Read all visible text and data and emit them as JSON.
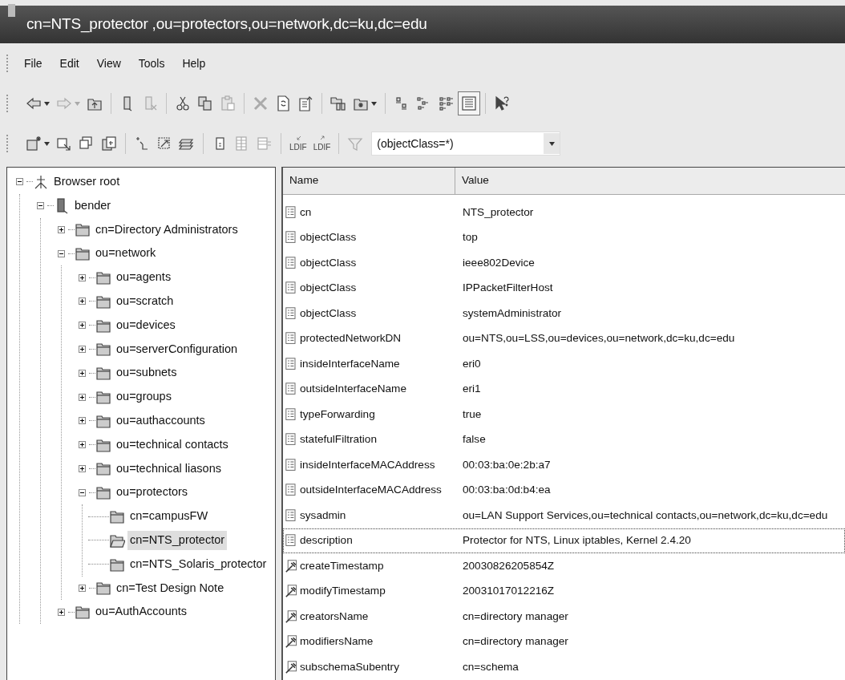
{
  "window": {
    "title": "cn=NTS_protector ,ou=protectors,ou=network,dc=ku,dc=edu"
  },
  "menu": [
    "File",
    "Edit",
    "View",
    "Tools",
    "Help"
  ],
  "toolbars": [
    [
      {
        "kind": "button",
        "dropdown": true,
        "disabled": false
      },
      {
        "kind": "button",
        "dropdown": true,
        "disabled": true
      },
      {
        "kind": "button",
        "dropdown": false,
        "disabled": false
      },
      {
        "kind": "separator"
      },
      {
        "kind": "button",
        "dropdown": false,
        "disabled": false
      },
      {
        "kind": "button",
        "dropdown": false,
        "disabled": true
      },
      {
        "kind": "separator"
      },
      {
        "kind": "button",
        "dropdown": false,
        "disabled": false
      },
      {
        "kind": "button",
        "dropdown": false,
        "disabled": false
      },
      {
        "kind": "button",
        "dropdown": false,
        "disabled": true
      },
      {
        "kind": "separator"
      },
      {
        "kind": "button",
        "dropdown": false,
        "disabled": true
      },
      {
        "kind": "button",
        "dropdown": false,
        "disabled": false
      },
      {
        "kind": "button",
        "dropdown": false,
        "disabled": false
      },
      {
        "kind": "separator"
      },
      {
        "kind": "button",
        "dropdown": false,
        "disabled": false
      },
      {
        "kind": "button",
        "dropdown": true,
        "disabled": false
      },
      {
        "kind": "separator"
      },
      {
        "kind": "button",
        "dropdown": false,
        "disabled": false,
        "selected": false
      },
      {
        "kind": "button",
        "dropdown": false,
        "disabled": false,
        "selected": false
      },
      {
        "kind": "button",
        "dropdown": false,
        "disabled": false,
        "selected": false
      },
      {
        "kind": "button",
        "dropdown": false,
        "disabled": false,
        "selected": true
      },
      {
        "kind": "separator"
      },
      {
        "kind": "button",
        "dropdown": false,
        "disabled": false
      }
    ],
    [
      {
        "kind": "button",
        "dropdown": true,
        "disabled": false
      },
      {
        "kind": "button",
        "dropdown": false,
        "disabled": false
      },
      {
        "kind": "button",
        "dropdown": false,
        "disabled": false
      },
      {
        "kind": "button",
        "dropdown": false,
        "disabled": false
      },
      {
        "kind": "separator"
      },
      {
        "kind": "button",
        "dropdown": false,
        "disabled": false
      },
      {
        "kind": "button",
        "dropdown": false,
        "disabled": false
      },
      {
        "kind": "button",
        "dropdown": false,
        "disabled": false
      },
      {
        "kind": "separator"
      },
      {
        "kind": "button",
        "dropdown": false,
        "disabled": false
      },
      {
        "kind": "button",
        "dropdown": false,
        "disabled": true
      },
      {
        "kind": "button",
        "dropdown": false,
        "disabled": true
      },
      {
        "kind": "separator"
      },
      {
        "kind": "button",
        "dropdown": false,
        "disabled": false,
        "label": "LDIF"
      },
      {
        "kind": "button",
        "dropdown": false,
        "disabled": false,
        "label": "LDIF"
      },
      {
        "kind": "separator"
      },
      {
        "kind": "button",
        "dropdown": false,
        "disabled": true
      },
      {
        "kind": "combo",
        "value": "(objectClass=*)"
      }
    ]
  ],
  "tree": [
    {
      "kind": "root",
      "label": "Browser root",
      "expanded": true,
      "selected": false,
      "children": [
        {
          "kind": "server",
          "label": "bender",
          "expanded": true,
          "selected": false,
          "children": [
            {
              "kind": "folder",
              "label": "cn=Directory Administrators",
              "expanded": false,
              "selected": false
            },
            {
              "kind": "folder",
              "label": "ou=network",
              "expanded": true,
              "selected": false,
              "children": [
                {
                  "kind": "folder",
                  "label": "ou=agents",
                  "expanded": false,
                  "selected": false
                },
                {
                  "kind": "folder",
                  "label": "ou=scratch",
                  "expanded": false,
                  "selected": false
                },
                {
                  "kind": "folder",
                  "label": "ou=devices",
                  "expanded": false,
                  "selected": false
                },
                {
                  "kind": "folder",
                  "label": "ou=serverConfiguration",
                  "expanded": false,
                  "selected": false
                },
                {
                  "kind": "folder",
                  "label": "ou=subnets",
                  "expanded": false,
                  "selected": false
                },
                {
                  "kind": "folder",
                  "label": "ou=groups",
                  "expanded": false,
                  "selected": false
                },
                {
                  "kind": "folder",
                  "label": "ou=authaccounts",
                  "expanded": false,
                  "selected": false
                },
                {
                  "kind": "folder",
                  "label": "ou=technical contacts",
                  "expanded": false,
                  "selected": false
                },
                {
                  "kind": "folder",
                  "label": "ou=technical liasons",
                  "expanded": false,
                  "selected": false
                },
                {
                  "kind": "folder",
                  "label": "ou=protectors",
                  "expanded": true,
                  "selected": false,
                  "children": [
                    {
                      "kind": "folder",
                      "label": "cn=campusFW",
                      "selected": false
                    },
                    {
                      "kind": "folder",
                      "label": "cn=NTS_protector",
                      "selected": true
                    },
                    {
                      "kind": "folder",
                      "label": "cn=NTS_Solaris_protector",
                      "selected": false
                    }
                  ]
                },
                {
                  "kind": "folder",
                  "label": "cn=Test Design Note",
                  "expanded": false,
                  "selected": false
                }
              ]
            },
            {
              "kind": "folder",
              "label": "ou=AuthAccounts",
              "expanded": false,
              "selected": false
            }
          ]
        }
      ]
    }
  ],
  "table": {
    "columns": [
      "Name",
      "Value"
    ],
    "rows": [
      {
        "kind": "attribute",
        "name": "cn",
        "value": "NTS_protector",
        "focused": false
      },
      {
        "kind": "attribute",
        "name": "objectClass",
        "value": "top",
        "focused": false
      },
      {
        "kind": "attribute",
        "name": "objectClass",
        "value": "ieee802Device",
        "focused": false
      },
      {
        "kind": "attribute",
        "name": "objectClass",
        "value": "IPPacketFilterHost",
        "focused": false
      },
      {
        "kind": "attribute",
        "name": "objectClass",
        "value": "systemAdministrator",
        "focused": false
      },
      {
        "kind": "attribute",
        "name": "protectedNetworkDN",
        "value": "ou=NTS,ou=LSS,ou=devices,ou=network,dc=ku,dc=edu",
        "focused": false
      },
      {
        "kind": "attribute",
        "name": "insideInterfaceName",
        "value": "eri0",
        "focused": false
      },
      {
        "kind": "attribute",
        "name": "outsideInterfaceName",
        "value": "eri1",
        "focused": false
      },
      {
        "kind": "attribute",
        "name": "typeForwarding",
        "value": "true",
        "focused": false
      },
      {
        "kind": "attribute",
        "name": "statefulFiltration",
        "value": "false",
        "focused": false
      },
      {
        "kind": "attribute",
        "name": "insideInterfaceMACAddress",
        "value": "00:03:ba:0e:2b:a7",
        "focused": false
      },
      {
        "kind": "attribute",
        "name": "outsideInterfaceMACAddress",
        "value": "00:03:ba:0d:b4:ea",
        "focused": false
      },
      {
        "kind": "attribute",
        "name": "sysadmin",
        "value": "ou=LAN Support Services,ou=technical contacts,ou=network,dc=ku,dc=edu",
        "focused": false
      },
      {
        "kind": "attribute",
        "name": "description",
        "value": "Protector for NTS, Linux iptables, Kernel 2.4.20",
        "focused": true
      },
      {
        "kind": "operational",
        "name": "createTimestamp",
        "value": "20030826205854Z",
        "focused": false
      },
      {
        "kind": "operational",
        "name": "modifyTimestamp",
        "value": "20031017012216Z",
        "focused": false
      },
      {
        "kind": "operational",
        "name": "creatorsName",
        "value": "cn=directory manager",
        "focused": false
      },
      {
        "kind": "operational",
        "name": "modifiersName",
        "value": "cn=directory manager",
        "focused": false
      },
      {
        "kind": "operational",
        "name": "subschemaSubentry",
        "value": "cn=schema",
        "focused": false
      }
    ]
  }
}
